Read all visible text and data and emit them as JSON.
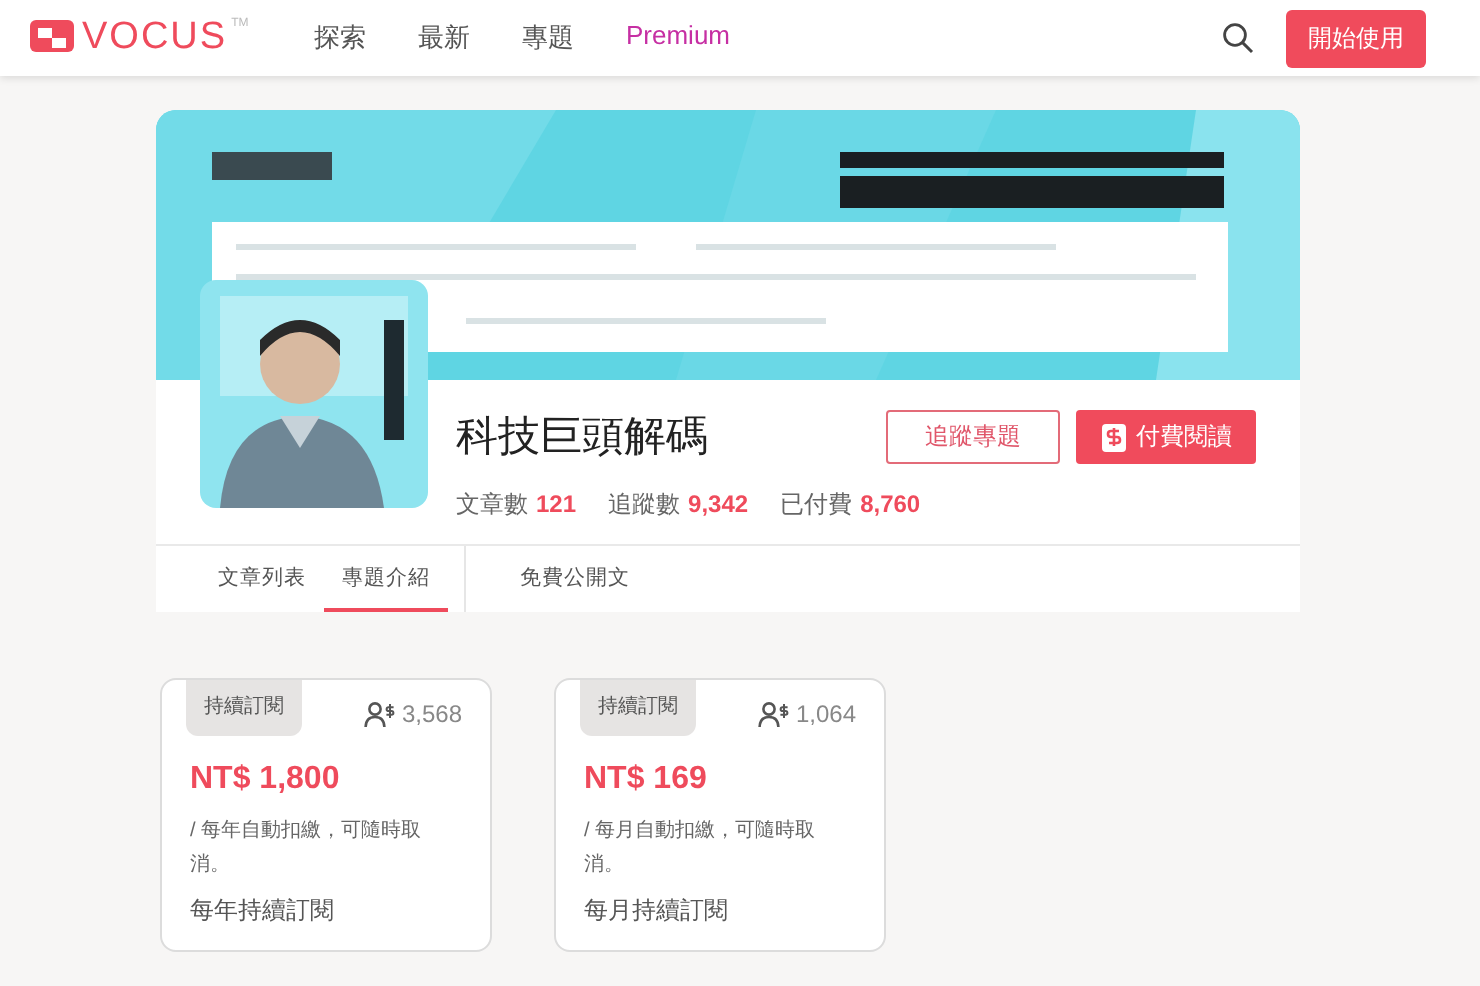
{
  "header": {
    "logo": "VOCUS",
    "logo_mark": "TM",
    "nav": [
      {
        "label": "探索",
        "kind": "plain"
      },
      {
        "label": "最新",
        "kind": "plain"
      },
      {
        "label": "專題",
        "kind": "plain"
      },
      {
        "label": "Premium",
        "kind": "premium"
      }
    ],
    "cta": "開始使用"
  },
  "salon": {
    "title": "科技巨頭解碼",
    "follow_button": "追蹤專題",
    "pay_button": "付費閱讀",
    "stats": [
      {
        "label": "文章數",
        "value": "121"
      },
      {
        "label": "追蹤數",
        "value": "9,342"
      },
      {
        "label": "已付費",
        "value": "8,760"
      }
    ],
    "tabs": [
      {
        "label": "文章列表",
        "selected": false
      },
      {
        "label": "專題介紹",
        "selected": true
      },
      {
        "label": "免費公開文",
        "selected": false
      }
    ]
  },
  "plans": [
    {
      "tag": "持續訂閱",
      "subscribers": "3,568",
      "price": "NT$ 1,800",
      "note": "/ 每年自動扣繳，可隨時取消。",
      "name": "每年持續訂閱"
    },
    {
      "tag": "持續訂閱",
      "subscribers": "1,064",
      "price": "NT$ 169",
      "note": "/ 每月自動扣繳，可隨時取消。",
      "name": "每月持續訂閱"
    }
  ]
}
